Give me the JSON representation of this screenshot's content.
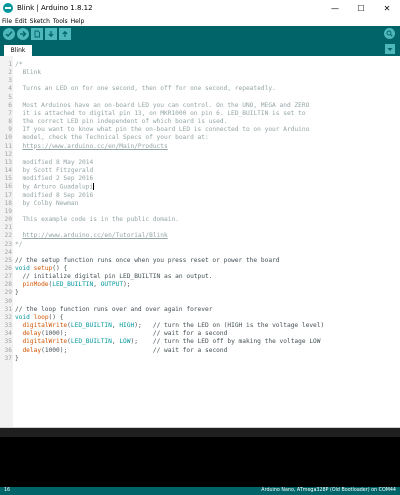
{
  "window": {
    "title": "Blink | Arduino 1.8.12",
    "controls": {
      "minimize": "—",
      "maximize": "☐",
      "close": "✕"
    }
  },
  "menu": [
    "File",
    "Edit",
    "Sketch",
    "Tools",
    "Help"
  ],
  "toolbar": {
    "buttons": [
      "verify-icon",
      "upload-icon",
      "new-icon",
      "open-icon",
      "save-icon"
    ],
    "serial_monitor": "serial-monitor-icon"
  },
  "tabs": [
    {
      "label": "Blink"
    }
  ],
  "editor": {
    "lines": [
      {
        "n": "1",
        "segs": [
          {
            "t": "/*",
            "c": "comment"
          }
        ]
      },
      {
        "n": "2",
        "segs": [
          {
            "t": "  Blink",
            "c": "comment"
          }
        ]
      },
      {
        "n": "3",
        "segs": []
      },
      {
        "n": "4",
        "segs": [
          {
            "t": "  Turns an LED on for one second, then off for one second, repeatedly.",
            "c": "comment"
          }
        ]
      },
      {
        "n": "5",
        "segs": []
      },
      {
        "n": "6",
        "segs": [
          {
            "t": "  Most Arduinos have an on-board LED you can control. On the UNO, MEGA and ZERO",
            "c": "comment"
          }
        ]
      },
      {
        "n": "7",
        "segs": [
          {
            "t": "  it is attached to digital pin 13, on MKR1000 on pin 6. LED_BUILTIN is set to",
            "c": "comment"
          }
        ]
      },
      {
        "n": "8",
        "segs": [
          {
            "t": "  the correct LED pin independent of which board is used.",
            "c": "comment"
          }
        ]
      },
      {
        "n": "9",
        "segs": [
          {
            "t": "  If you want to know what pin the on-board LED is connected to on your Arduino",
            "c": "comment"
          }
        ]
      },
      {
        "n": "10",
        "segs": [
          {
            "t": "  model, check the Technical Specs of your board at:",
            "c": "comment"
          }
        ]
      },
      {
        "n": "11",
        "segs": [
          {
            "t": "  ",
            "c": "comment"
          },
          {
            "t": "https://www.arduino.cc/en/Main/Products",
            "c": "link"
          }
        ]
      },
      {
        "n": "12",
        "segs": []
      },
      {
        "n": "13",
        "segs": [
          {
            "t": "  modified 8 May 2014",
            "c": "comment"
          }
        ]
      },
      {
        "n": "14",
        "segs": [
          {
            "t": "  by Scott Fitzgerald",
            "c": "comment"
          }
        ]
      },
      {
        "n": "15",
        "segs": [
          {
            "t": "  modified 2 Sep 2016",
            "c": "comment"
          }
        ]
      },
      {
        "n": "16",
        "segs": [
          {
            "t": "  by Arturo Guadalupi",
            "c": "comment"
          },
          {
            "t": "",
            "c": "caret"
          }
        ]
      },
      {
        "n": "17",
        "segs": [
          {
            "t": "  modified 8 Sep 2016",
            "c": "comment"
          }
        ]
      },
      {
        "n": "18",
        "segs": [
          {
            "t": "  by Colby Newman",
            "c": "comment"
          }
        ]
      },
      {
        "n": "19",
        "segs": []
      },
      {
        "n": "20",
        "segs": [
          {
            "t": "  This example code is in the public domain.",
            "c": "comment"
          }
        ]
      },
      {
        "n": "21",
        "segs": []
      },
      {
        "n": "22",
        "segs": [
          {
            "t": "  ",
            "c": "comment"
          },
          {
            "t": "http://www.arduino.cc/en/Tutorial/Blink",
            "c": "link"
          }
        ]
      },
      {
        "n": "23",
        "segs": [
          {
            "t": "*/",
            "c": "comment"
          }
        ]
      },
      {
        "n": "24",
        "segs": []
      },
      {
        "n": "25",
        "segs": [
          {
            "t": "// the setup function runs once when you press reset or power the board",
            "c": "normal"
          }
        ]
      },
      {
        "n": "26",
        "segs": [
          {
            "t": "void",
            "c": "kw-type"
          },
          {
            "t": " ",
            "c": "normal"
          },
          {
            "t": "setup",
            "c": "kw-func"
          },
          {
            "t": "() {",
            "c": "normal"
          }
        ]
      },
      {
        "n": "27",
        "segs": [
          {
            "t": "  // initialize digital pin LED_BUILTIN as an output.",
            "c": "normal"
          }
        ]
      },
      {
        "n": "28",
        "segs": [
          {
            "t": "  ",
            "c": "normal"
          },
          {
            "t": "pinMode",
            "c": "kw-func"
          },
          {
            "t": "(",
            "c": "normal"
          },
          {
            "t": "LED_BUILTIN",
            "c": "kw-const"
          },
          {
            "t": ", ",
            "c": "normal"
          },
          {
            "t": "OUTPUT",
            "c": "kw-const"
          },
          {
            "t": ");",
            "c": "normal"
          }
        ]
      },
      {
        "n": "29",
        "segs": [
          {
            "t": "}",
            "c": "normal"
          }
        ]
      },
      {
        "n": "30",
        "segs": []
      },
      {
        "n": "31",
        "segs": [
          {
            "t": "// the loop function runs over and over again forever",
            "c": "normal"
          }
        ]
      },
      {
        "n": "32",
        "segs": [
          {
            "t": "void",
            "c": "kw-type"
          },
          {
            "t": " ",
            "c": "normal"
          },
          {
            "t": "loop",
            "c": "kw-func"
          },
          {
            "t": "() {",
            "c": "normal"
          }
        ]
      },
      {
        "n": "33",
        "segs": [
          {
            "t": "  ",
            "c": "normal"
          },
          {
            "t": "digitalWrite",
            "c": "kw-func"
          },
          {
            "t": "(",
            "c": "normal"
          },
          {
            "t": "LED_BUILTIN",
            "c": "kw-const"
          },
          {
            "t": ", ",
            "c": "normal"
          },
          {
            "t": "HIGH",
            "c": "kw-const"
          },
          {
            "t": ");   // turn the LED on (HIGH is the voltage level)",
            "c": "normal"
          }
        ]
      },
      {
        "n": "34",
        "segs": [
          {
            "t": "  ",
            "c": "normal"
          },
          {
            "t": "delay",
            "c": "kw-func"
          },
          {
            "t": "(1000);                       // wait for a second",
            "c": "normal"
          }
        ]
      },
      {
        "n": "35",
        "segs": [
          {
            "t": "  ",
            "c": "normal"
          },
          {
            "t": "digitalWrite",
            "c": "kw-func"
          },
          {
            "t": "(",
            "c": "normal"
          },
          {
            "t": "LED_BUILTIN",
            "c": "kw-const"
          },
          {
            "t": ", ",
            "c": "normal"
          },
          {
            "t": "LOW",
            "c": "kw-const"
          },
          {
            "t": ");    // turn the LED off by making the voltage LOW",
            "c": "normal"
          }
        ]
      },
      {
        "n": "36",
        "segs": [
          {
            "t": "  ",
            "c": "normal"
          },
          {
            "t": "delay",
            "c": "kw-func"
          },
          {
            "t": "(1000);                       // wait for a second",
            "c": "normal"
          }
        ]
      },
      {
        "n": "37",
        "segs": [
          {
            "t": "}",
            "c": "normal"
          }
        ]
      }
    ]
  },
  "status": {
    "line": "16",
    "board": "Arduino Nano, ATmega328P (Old Bootloader) on COM44"
  },
  "colors": {
    "toolbar": "#006468",
    "button": "#4db7bb",
    "comment": "#95a5a6",
    "function": "#d35400",
    "keyword": "#00979d"
  }
}
